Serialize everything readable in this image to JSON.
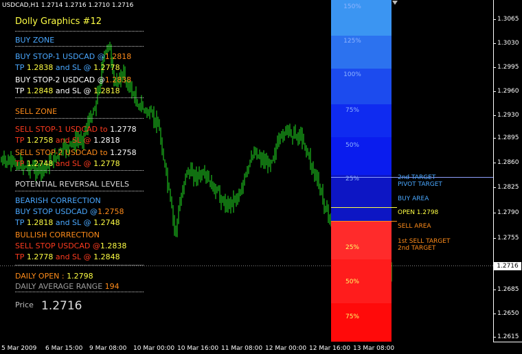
{
  "header": {
    "symbol_line": "USDCAD,H1  1.2714 1.2716 1.2710 1.2716"
  },
  "title": "Dolly Graphics #12",
  "lines": [
    [
      {
        "t": "BUY ZONE",
        "c": "#4aa8ff"
      }
    ],
    [
      {
        "t": "BUY STOP-1  USDCAD  @",
        "c": "#4aa8ff"
      },
      {
        "t": "1.2818",
        "c": "#ff8c1a"
      }
    ],
    [
      {
        "t": "TP ",
        "c": "#4aa8ff"
      },
      {
        "t": "1.2838",
        "c": "#ffff44"
      },
      {
        "t": " and SL @ ",
        "c": "#4aa8ff"
      },
      {
        "t": "1.2778",
        "c": "#ffff44"
      }
    ],
    [
      {
        "t": "BUY STOP-2  USDCAD  @",
        "c": "#ffffff"
      },
      {
        "t": "1.2838",
        "c": "#ff8c1a"
      }
    ],
    [
      {
        "t": "TP ",
        "c": "#ffffff"
      },
      {
        "t": "1.2848",
        "c": "#ffff44"
      },
      {
        "t": " and SL @ ",
        "c": "#ffffff"
      },
      {
        "t": "1.2818",
        "c": "#ffff44"
      }
    ],
    [
      {
        "t": "SELL ZONE",
        "c": "#ff8c1a"
      }
    ],
    [
      {
        "t": "SELL STOP-1  USDCAD  to ",
        "c": "#ff3b1f"
      },
      {
        "t": "1.2778",
        "c": "#ffffff"
      }
    ],
    [
      {
        "t": "TP ",
        "c": "#ff3b1f"
      },
      {
        "t": "1.2758",
        "c": "#ffff44"
      },
      {
        "t": " and SL @ ",
        "c": "#ff3b1f"
      },
      {
        "t": "1.2818",
        "c": "#ffffff"
      }
    ],
    [
      {
        "t": "SELL STOP-2  USDCAD  to ",
        "c": "#ff8c1a"
      },
      {
        "t": "1.2758",
        "c": "#ffffff"
      }
    ],
    [
      {
        "t": "TP ",
        "c": "#ff3b1f"
      },
      {
        "t": "1.2748",
        "c": "#ffff44"
      },
      {
        "t": " and SL @ ",
        "c": "#ff3b1f"
      },
      {
        "t": "1.2778",
        "c": "#ffff44"
      }
    ],
    [
      {
        "t": "POTENTIAL REVERSAL LEVELS",
        "c": "#d8d8d8"
      }
    ],
    [
      {
        "t": "BEARISH CORRECTION",
        "c": "#4aa8ff"
      }
    ],
    [
      {
        "t": "BUY STOP USDCAD  @",
        "c": "#4aa8ff"
      },
      {
        "t": "1.2758",
        "c": "#ff8c1a"
      }
    ],
    [
      {
        "t": "TP ",
        "c": "#4aa8ff"
      },
      {
        "t": "1.2818",
        "c": "#ffff44"
      },
      {
        "t": " and SL @ ",
        "c": "#4aa8ff"
      },
      {
        "t": "1.2748",
        "c": "#ffff44"
      }
    ],
    [
      {
        "t": "BULLISH CORRECTION",
        "c": "#ff8c1a"
      }
    ],
    [
      {
        "t": "SELL STOP USDCAD  @",
        "c": "#ff3b1f"
      },
      {
        "t": "1.2838",
        "c": "#ffff44"
      }
    ],
    [
      {
        "t": "TP ",
        "c": "#ff3b1f"
      },
      {
        "t": "1.2778",
        "c": "#ffff44"
      },
      {
        "t": " and SL @ ",
        "c": "#ff3b1f"
      },
      {
        "t": "1.2848",
        "c": "#ffff44"
      }
    ],
    [
      {
        "t": "DAILY OPEN  :  ",
        "c": "#ff8c1a"
      },
      {
        "t": "1.2798",
        "c": "#ffff44"
      }
    ],
    [
      {
        "t": "DAILY AVERAGE RANGE  ",
        "c": "#9c9c9c"
      },
      {
        "t": "194",
        "c": "#ff8c1a"
      }
    ]
  ],
  "price": {
    "label": "Price",
    "value": "1.2716"
  },
  "price_axis": [
    "1.3065",
    "1.3030",
    "1.2995",
    "1.2960",
    "1.2930",
    "1.2895",
    "1.2860",
    "1.2825",
    "1.2790",
    "1.2755",
    "1.2716",
    "1.2685",
    "1.2650",
    "1.2615"
  ],
  "current_price": "1.2716",
  "time_axis": [
    "5 Mar 2009",
    "6 Mar 15:00",
    "9 Mar 08:00",
    "10 Mar 00:00",
    "10 Mar 16:00",
    "11 Mar 08:00",
    "12 Mar 00:00",
    "12 Mar 16:00",
    "13 Mar 08:00"
  ],
  "zones": [
    {
      "pct": "150%",
      "color": "#3b95f2"
    },
    {
      "pct": "125%",
      "color": "#2c72ef"
    },
    {
      "pct": "100%",
      "color": "#1c4bee"
    },
    {
      "pct": "75%",
      "color": "#0f2bf0"
    },
    {
      "pct": "50%",
      "color": "#0a1cee"
    },
    {
      "pct": "25%",
      "color": "#0d16c4"
    },
    {
      "pct": "25%",
      "color": "#ff2b2b"
    },
    {
      "pct": "50%",
      "color": "#ff1c1c"
    },
    {
      "pct": "75%",
      "color": "#ff0a0a"
    }
  ],
  "levels": [
    {
      "label": "2nd TARGET",
      "color": "#4aa8ff"
    },
    {
      "label": "PIVOT TARGET",
      "color": "#4aa8ff"
    },
    {
      "label": "BUY AREA",
      "color": "#4aa8ff"
    },
    {
      "label": "OPEN 1.2798",
      "color": "#ffff44"
    },
    {
      "label": "SELL AREA",
      "color": "#ff8c1a"
    },
    {
      "label": "1st SELL TARGET",
      "color": "#ff8c1a"
    },
    {
      "label": "2nd TARGET",
      "color": "#ff8c1a"
    }
  ],
  "colors": {
    "background": "#000000",
    "candle": "#22e022",
    "grid": "#888888"
  }
}
